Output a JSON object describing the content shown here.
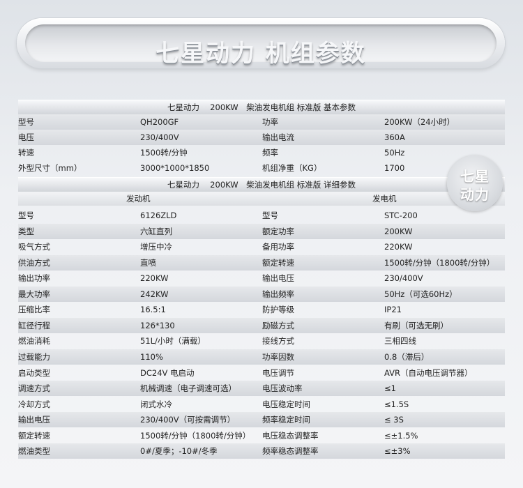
{
  "banner": {
    "title": "七星动力 机组参数"
  },
  "basic": {
    "header": "七星动力　 200KW　柴油发电机组 标准版 基本参数",
    "rows": [
      [
        "型号",
        "QH200GF",
        "功率",
        "200KW（24小时）"
      ],
      [
        "电压",
        "230/400V",
        "输出电流",
        "360A"
      ],
      [
        "转速",
        "1500转/分钟",
        "频率",
        "50Hz"
      ],
      [
        "外型尺寸（mm）",
        "3000*1000*1850",
        "机组净重（KG）",
        "1700"
      ]
    ]
  },
  "detail": {
    "header": "七星动力　 200KW　柴油发电机组 标准版 详细参数",
    "engine_label": "发动机",
    "generator_label": "发电机",
    "rows": [
      [
        "型号",
        "6126ZLD",
        "型号",
        "STC-200"
      ],
      [
        "类型",
        "六缸直列",
        "额定功率",
        "200KW"
      ],
      [
        "吸气方式",
        "增压中冷",
        "备用功率",
        "220KW"
      ],
      [
        "供油方式",
        "直喷",
        "额定转速",
        "1500转/分钟（1800转/分钟）"
      ],
      [
        "输出功率",
        "220KW",
        "输出电压",
        "230/400V"
      ],
      [
        "最大功率",
        "242KW",
        "输出频率",
        "50Hz（可选60Hz）"
      ],
      [
        "压缩比率",
        "16.5:1",
        "防护等级",
        "IP21"
      ],
      [
        "缸径行程",
        "126*130",
        "励磁方式",
        "有刷（可选无刷）"
      ],
      [
        "燃油消耗",
        "51L/小时（满载）",
        "接线方式",
        "三相四线"
      ],
      [
        "过载能力",
        "110%",
        "功率因数",
        "0.8（滞后）"
      ],
      [
        "启动类型",
        "DC24V 电启动",
        "电压调节",
        "AVR（自动电压调节器）"
      ],
      [
        "调速方式",
        "机械调速（电子调速可选）",
        "电压波动率",
        "≤1"
      ],
      [
        "冷却方式",
        "闭式水冷",
        "电压稳定时间",
        "≤1.5S"
      ],
      [
        "输出电压",
        "230/400V（可按需调节）",
        "频率稳定时间",
        "≤ 3S"
      ],
      [
        "额定转速",
        "1500转/分钟（1800转/分钟）",
        "电压稳态调整率",
        "≤±1.5%"
      ],
      [
        "燃油类型",
        "0#/夏季；-10#/冬季",
        "频率稳态调整率",
        "≤±3%"
      ]
    ]
  },
  "badge": {
    "line1": "七星",
    "line2": "动力"
  }
}
